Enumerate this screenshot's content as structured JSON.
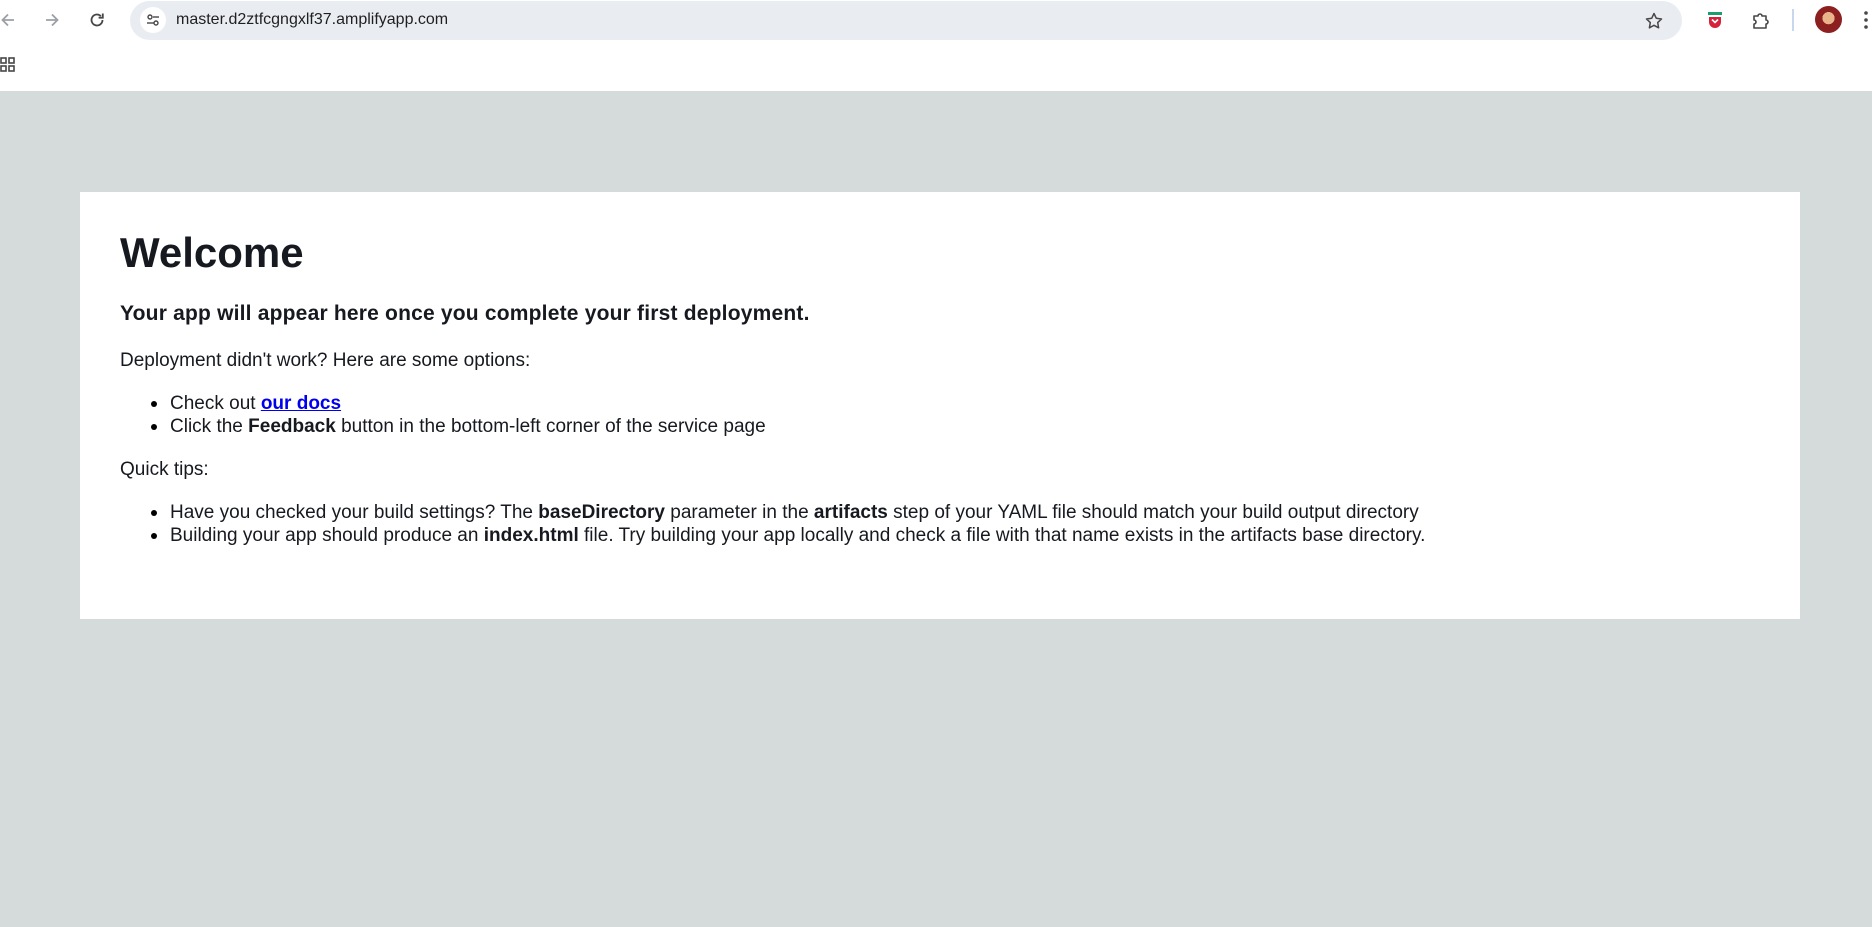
{
  "browser": {
    "url": "master.d2ztfcgngxlf37.amplifyapp.com",
    "icons": {
      "back": "arrow-left-icon",
      "forward": "arrow-right-icon",
      "reload": "reload-icon",
      "site_info": "tune-icon",
      "bookmark": "star-icon",
      "extension_1": "shield-extension-icon",
      "extensions": "puzzle-icon",
      "profile": "avatar",
      "menu": "kebab-menu-icon",
      "apps": "apps-grid-icon"
    }
  },
  "page": {
    "background_color": "#d5dbdb",
    "card_color": "#ffffff",
    "title": "Welcome",
    "subtitle": "Your app will appear here once you complete your first deployment.",
    "options_intro": "Deployment didn't work? Here are some options:",
    "options": {
      "docs_prefix": "Check out ",
      "docs_link": "our docs",
      "feedback_prefix": "Click the ",
      "feedback_bold": "Feedback",
      "feedback_suffix": " button in the bottom-left corner of the service page"
    },
    "tips_intro": "Quick tips:",
    "tips": {
      "tip1_a": "Have you checked your build settings? The ",
      "tip1_b": "baseDirectory",
      "tip1_c": " parameter in the ",
      "tip1_d": "artifacts",
      "tip1_e": " step of your YAML file should match your build output directory",
      "tip2_a": "Building your app should produce an ",
      "tip2_b": "index.html",
      "tip2_c": " file. Try building your app locally and check a file with that name exists in the artifacts base directory."
    }
  }
}
